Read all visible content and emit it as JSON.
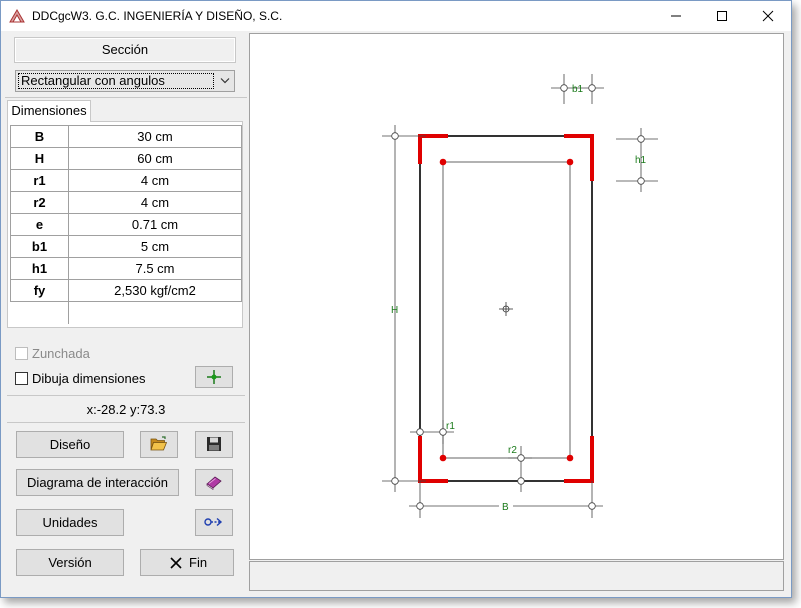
{
  "window": {
    "title": "DDCgcW3. G.C. INGENIERÍA Y DISEÑO, S.C.",
    "icon": "ddc-logo-icon"
  },
  "section": {
    "label": "Sección",
    "selected": "Rectangular con angulos"
  },
  "dimensions_tab": {
    "label": "Dimensiones",
    "rows": [
      {
        "key": "B",
        "value": "30 cm"
      },
      {
        "key": "H",
        "value": "60 cm"
      },
      {
        "key": "r1",
        "value": "4 cm"
      },
      {
        "key": "r2",
        "value": "4 cm"
      },
      {
        "key": "e",
        "value": "0.71 cm"
      },
      {
        "key": "b1",
        "value": "5 cm"
      },
      {
        "key": "h1",
        "value": "7.5 cm"
      },
      {
        "key": "fy",
        "value": "2,530 kgf/cm2"
      }
    ]
  },
  "options": {
    "zunchada": {
      "label": "Zunchada",
      "checked": false,
      "enabled": false
    },
    "dibuja": {
      "label": "Dibuja dimensiones",
      "checked": false,
      "enabled": true
    }
  },
  "coords": {
    "text": "x:-28.2 y:73.3"
  },
  "buttons": {
    "diseno": "Diseño",
    "diagrama": "Diagrama de interacción",
    "unidades": "Unidades",
    "version": "Versión",
    "fin": "Fin"
  },
  "drawing": {
    "labels": {
      "b1": "b1",
      "h1": "h1",
      "H": "H",
      "r1": "r1",
      "r2": "r2",
      "B": "B"
    },
    "colors": {
      "section": "#000000",
      "angle": "#e00000",
      "dimension": "#1a7a1a",
      "rebar": "#e00000"
    }
  }
}
